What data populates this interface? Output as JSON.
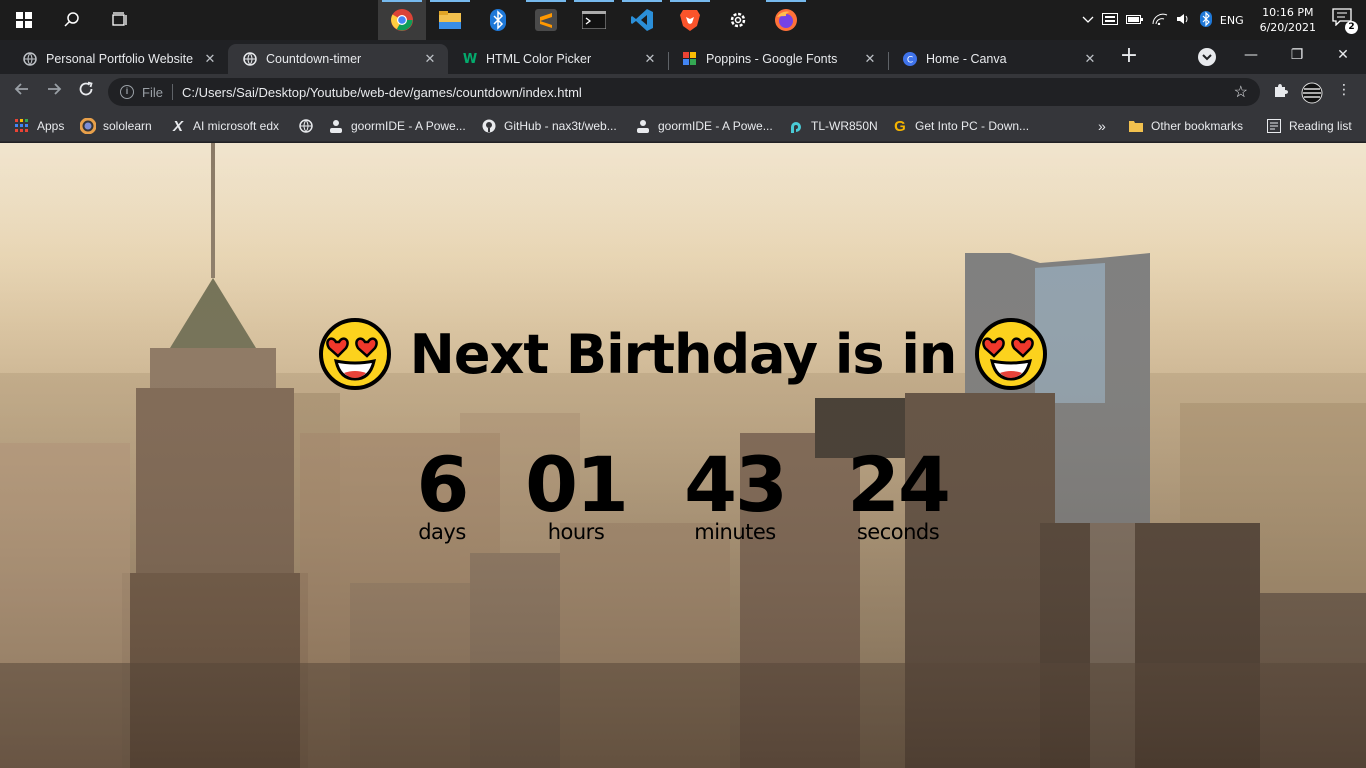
{
  "taskbar": {
    "tray": {
      "language": "ENG",
      "time": "10:16 PM",
      "date": "6/20/2021",
      "notification_count": "2"
    }
  },
  "tabs": [
    {
      "title": "Personal Portfolio Website",
      "active": false
    },
    {
      "title": "Countdown-timer",
      "active": true
    },
    {
      "title": "HTML Color Picker",
      "active": false
    },
    {
      "title": "Poppins - Google Fonts",
      "active": false
    },
    {
      "title": "Home - Canva",
      "active": false
    }
  ],
  "address_bar": {
    "scheme_label": "File",
    "url": "C:/Users/Sai/Desktop/Youtube/web-dev/games/countdown/index.html"
  },
  "bookmarks": [
    {
      "label": "Apps"
    },
    {
      "label": "sololearn"
    },
    {
      "label": "AI microsoft edx"
    },
    {
      "label": ""
    },
    {
      "label": "goormIDE - A Powe..."
    },
    {
      "label": "GitHub - nax3t/web..."
    },
    {
      "label": "goormIDE - A Powe..."
    },
    {
      "label": "TL-WR850N"
    },
    {
      "label": "Get Into PC - Down..."
    },
    {
      "label": "Other bookmarks"
    },
    {
      "label": "Reading list"
    }
  ],
  "bookmarks_more": "»",
  "page": {
    "heading": "Next Birthday is in",
    "countdown": [
      {
        "value": "6",
        "unit": "days"
      },
      {
        "value": "01",
        "unit": "hours"
      },
      {
        "value": "43",
        "unit": "minutes"
      },
      {
        "value": "24",
        "unit": "seconds"
      }
    ]
  },
  "colors": {
    "taskbar_bg": "#1c1c1c",
    "browser_frame": "#202124",
    "toolbar_bg": "#35363a",
    "text_light": "#e8eaed",
    "heading_text": "#000000"
  }
}
